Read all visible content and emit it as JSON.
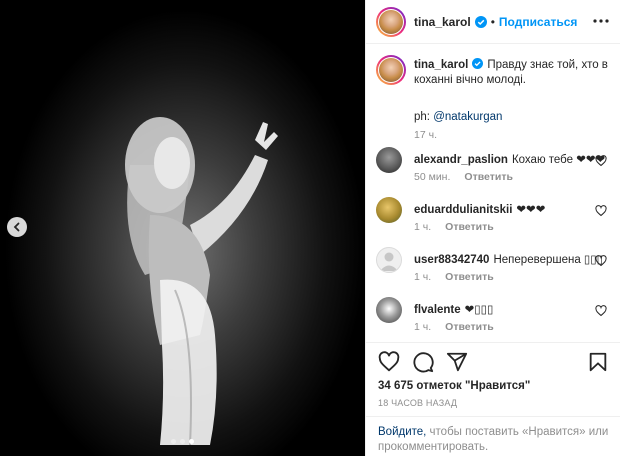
{
  "post": {
    "author": "tina_karol",
    "separator": "•",
    "follow_label": "Подписаться",
    "image_dots": 3,
    "active_dot": 2
  },
  "caption": {
    "author": "tina_karol",
    "text": "Правду знає той, хто в коханні вічно молоді.",
    "ph_prefix": "ph: ",
    "ph_mention": "@natakurgan",
    "time": "17 ч."
  },
  "comments": [
    {
      "user": "alexandr_paslion",
      "text": "Кохаю тебе ❤❤❤",
      "time": "50 мин.",
      "reply": "Ответить"
    },
    {
      "user": "eduarddulianitskii",
      "text": "❤❤❤",
      "time": "1 ч.",
      "reply": "Ответить"
    },
    {
      "user": "user88342740",
      "text": "Неперевершена ▯▯▯",
      "time": "1 ч.",
      "reply": "Ответить"
    },
    {
      "user": "flvalente",
      "text": "❤▯▯▯",
      "time": "1 ч.",
      "reply": "Ответить"
    }
  ],
  "likes": "34 675 отметок \"Нравится\"",
  "posted_ago": "18 ЧАСОВ НАЗАД",
  "footer": {
    "login_label": "Войдите,",
    "rest": " чтобы поставить «Нравится» или прокомментировать."
  },
  "colors": {
    "accent": "#0095f6",
    "link": "#00376b",
    "muted": "#8e8e8e"
  },
  "icons": [
    "chevron-left-icon",
    "verified-badge-icon",
    "more-options-icon",
    "heart-icon",
    "comment-icon",
    "share-icon",
    "bookmark-icon"
  ]
}
